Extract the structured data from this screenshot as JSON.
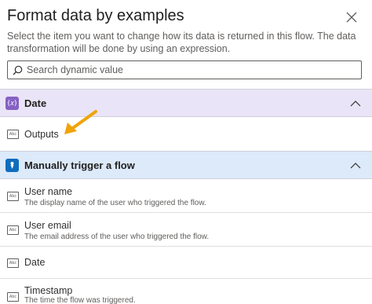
{
  "panel": {
    "title": "Format data by examples",
    "description": "Select the item you want to change how its data is returned in this flow. The data transformation will be done by using an expression."
  },
  "search": {
    "placeholder": "Search dynamic value"
  },
  "groups": [
    {
      "label": "Date",
      "icon": "expression-icon",
      "color": "#8661c5",
      "items": [
        {
          "name": "Outputs",
          "subtitle": ""
        }
      ]
    },
    {
      "label": "Manually trigger a flow",
      "icon": "manual-trigger-icon",
      "color": "#0f6cbd",
      "items": [
        {
          "name": "User name",
          "subtitle": "The display name of the user who triggered the flow."
        },
        {
          "name": "User email",
          "subtitle": "The email address of the user who triggered the flow."
        },
        {
          "name": "Date",
          "subtitle": ""
        },
        {
          "name": "Timestamp",
          "subtitle": "The time the flow was triggered."
        }
      ]
    }
  ],
  "colors": {
    "annotation_arrow": "#f0a30a"
  }
}
